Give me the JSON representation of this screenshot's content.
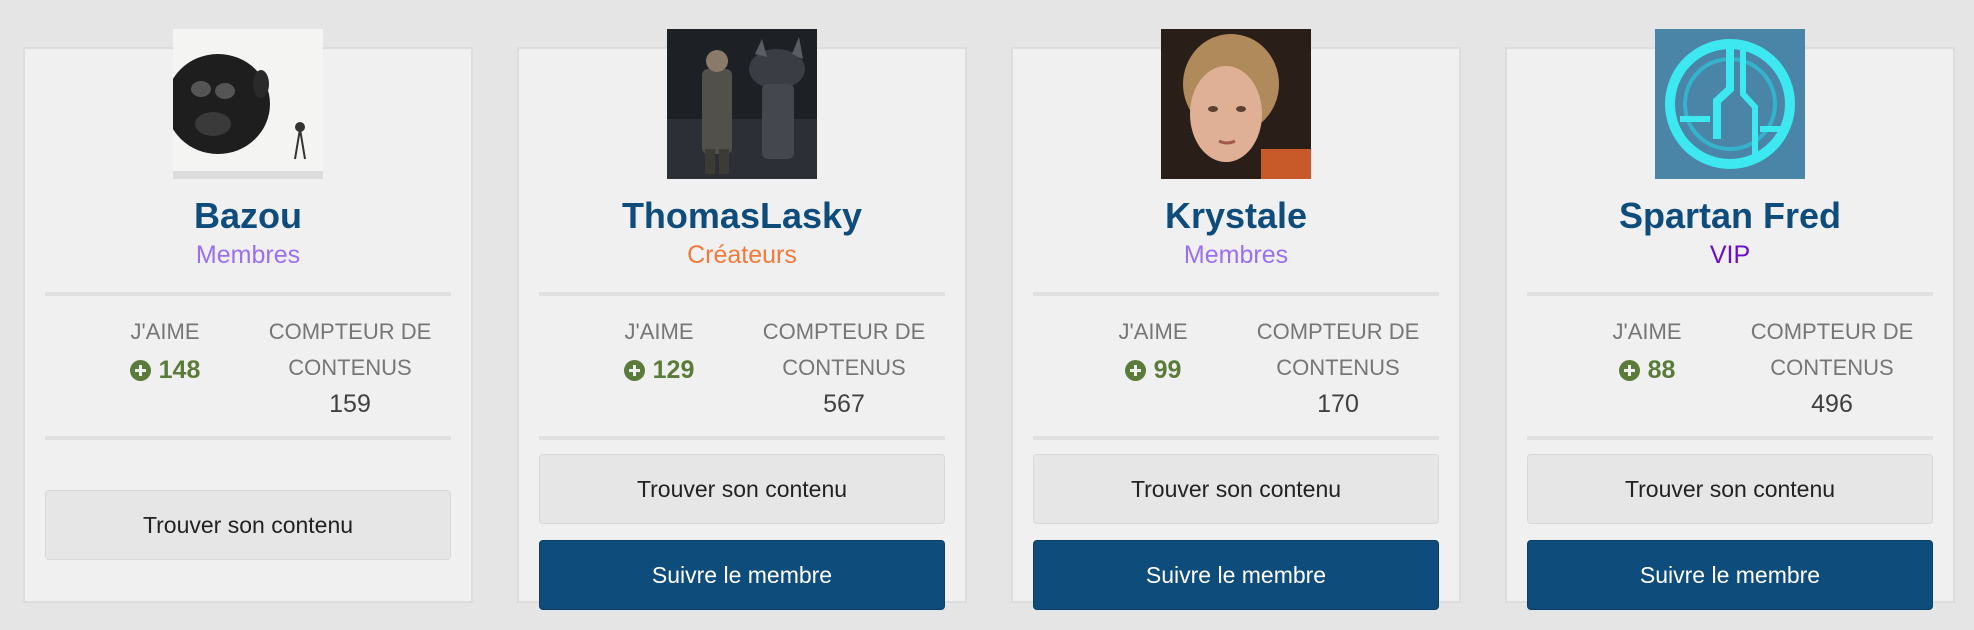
{
  "members": [
    {
      "name": "Bazou",
      "group": "Membres",
      "group_color": "#9a6ff0",
      "likes_label": "J'AIME",
      "likes": "148",
      "content_label": "COMPTEUR DE CONTENUS",
      "content_count": "159",
      "find_label": "Trouver son contenu",
      "follow_label": ""
    },
    {
      "name": "ThomasLasky",
      "group": "Créateurs",
      "group_color": "#f07a3a",
      "likes_label": "J'AIME",
      "likes": "129",
      "content_label": "COMPTEUR DE CONTENUS",
      "content_count": "567",
      "find_label": "Trouver son contenu",
      "follow_label": "Suivre le membre"
    },
    {
      "name": "Krystale",
      "group": "Membres",
      "group_color": "#9a6ff0",
      "likes_label": "J'AIME",
      "likes": "99",
      "content_label": "COMPTEUR DE CONTENUS",
      "content_count": "170",
      "find_label": "Trouver son contenu",
      "follow_label": "Suivre le membre"
    },
    {
      "name": "Spartan Fred",
      "group": "VIP",
      "group_color": "#6a0dc8",
      "likes_label": "J'AIME",
      "likes": "88",
      "content_label": "COMPTEUR DE CONTENUS",
      "content_count": "496",
      "find_label": "Trouver son contenu",
      "follow_label": "Suivre le membre"
    }
  ],
  "colors": {
    "name": "#0e4c7b",
    "likes": "#5a7b3a",
    "follow_button": "#0e4c7b"
  }
}
